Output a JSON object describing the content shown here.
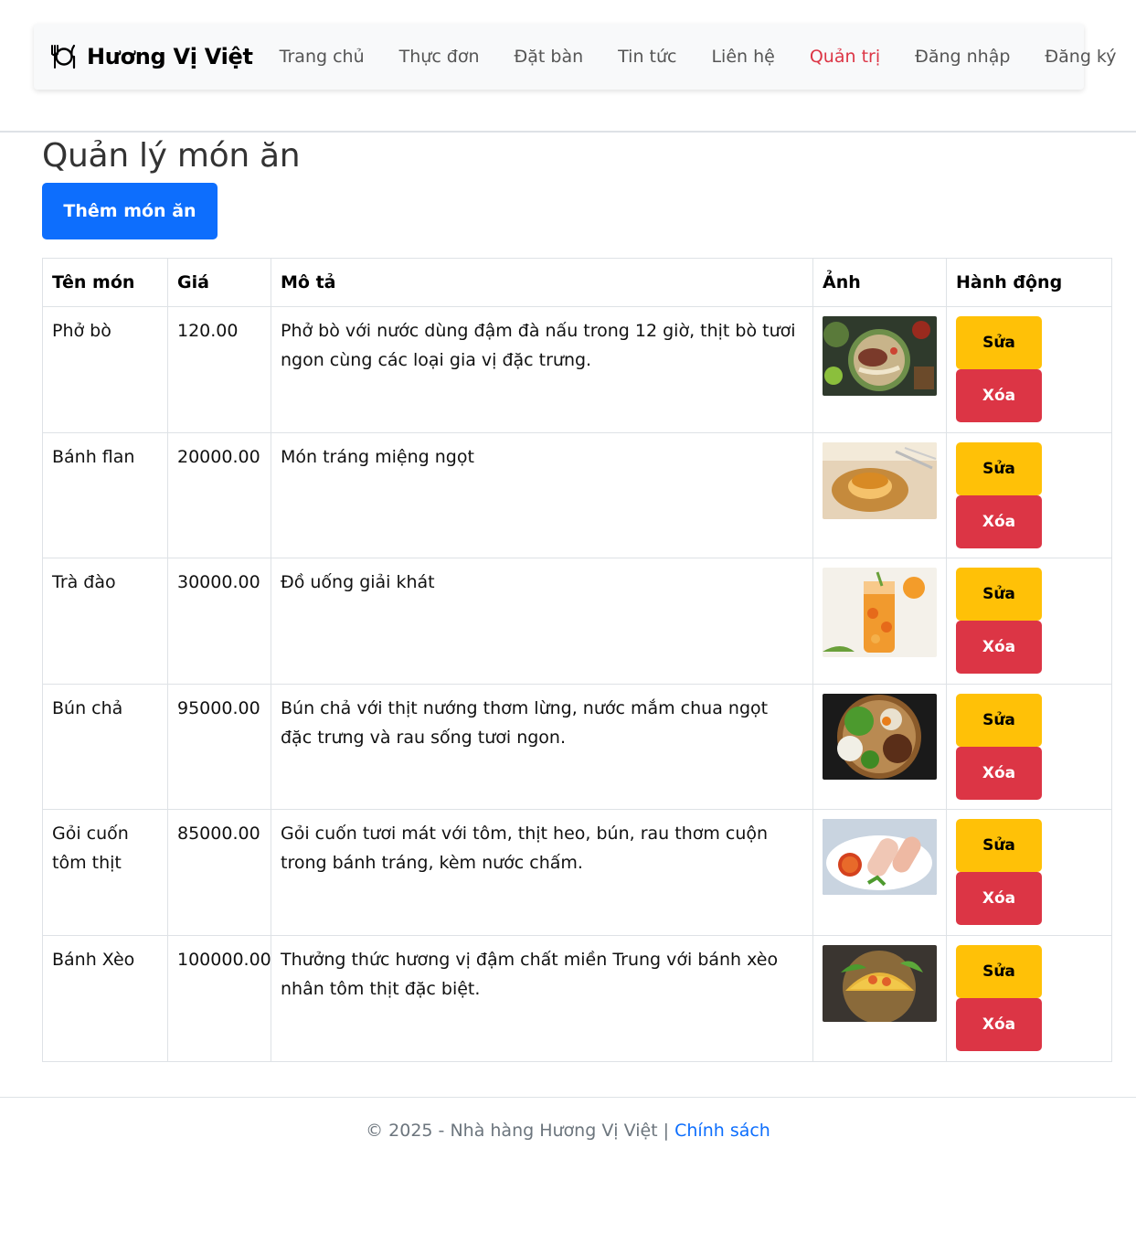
{
  "navbar": {
    "brand": "Hương Vị Việt",
    "brand_icon": "plate-cutlery-icon",
    "links": [
      "Trang chủ",
      "Thực đơn",
      "Đặt bàn",
      "Tin tức",
      "Liên hệ",
      "Quản trị",
      "Đăng nhập",
      "Đăng ký"
    ],
    "active_link": "Quản trị",
    "active_color": "#dc3545"
  },
  "page": {
    "title": "Quản lý món ăn",
    "add_button": "Thêm món ăn"
  },
  "table": {
    "headers": [
      "Tên món",
      "Giá",
      "Mô tả",
      "Ảnh",
      "Hành động"
    ],
    "rows": [
      {
        "name": "Phở bò",
        "price": "120.00",
        "description": "Phở bò với nước dùng đậm đà nấu trong 12 giờ, thịt bò tươi ngon cùng các loại gia vị đặc trưng.",
        "image": "pho-bo-photo"
      },
      {
        "name": "Bánh flan",
        "price": "20000.00",
        "description": "Món tráng miệng ngọt",
        "image": "banh-flan-photo"
      },
      {
        "name": "Trà đào",
        "price": "30000.00",
        "description": "Đồ uống giải khát",
        "image": "tra-dao-photo"
      },
      {
        "name": "Bún chả",
        "price": "95000.00",
        "description": "Bún chả với thịt nướng thơm lừng, nước mắm chua ngọt đặc trưng và rau sống tươi ngon.",
        "image": "bun-cha-photo"
      },
      {
        "name": "Gỏi cuốn tôm thịt",
        "price": "85000.00",
        "description": "Gỏi cuốn tươi mát với tôm, thịt heo, bún, rau thơm cuộn trong bánh tráng, kèm nước chấm.",
        "image": "goi-cuon-photo"
      },
      {
        "name": "Bánh Xèo",
        "price": "100000.00",
        "description": "Thưởng thức hương vị đậm chất miền Trung với bánh xèo nhân tôm thịt đặc biệt.",
        "image": "banh-xeo-photo"
      }
    ],
    "edit_label": "Sửa",
    "delete_label": "Xóa"
  },
  "footer": {
    "text": "© 2025 - Nhà hàng Hương Vị Việt | ",
    "link": "Chính sách"
  },
  "colors": {
    "primary": "#0d6efd",
    "warning": "#ffc107",
    "danger": "#dc3545"
  }
}
